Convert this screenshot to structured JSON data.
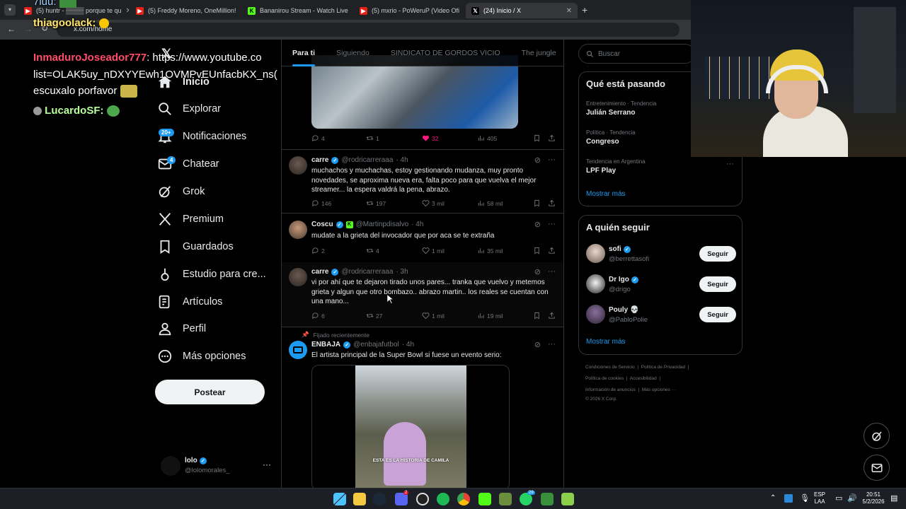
{
  "browser": {
    "tabs": [
      {
        "title": "(5) huntr - ▒▒▒▒ porque te qu",
        "icon": "youtube-icon"
      },
      {
        "title": "(5) Freddy Moreno, OneMillion!",
        "icon": "youtube-icon"
      },
      {
        "title": "Bananirou Stream - Watch Live",
        "icon": "kick-icon"
      },
      {
        "title": "(5) mxrio - PoWeruP (Video Ofi",
        "icon": "youtube-icon"
      },
      {
        "title": "(24) Inicio / X",
        "icon": "x-icon"
      }
    ],
    "url": "x.com/home"
  },
  "overlay_chat": {
    "line0": "7luu:",
    "line1_user": "thiagoolack:",
    "line2_user": "InmaduroJoseador777",
    "line2_text": ": https://www.youtube.co",
    "line3": "list=OLAK5uy_nDXYYEwh1OVMPvEUnfacbKX_ns(",
    "line4": "escuxalo porfavor",
    "line5_user": "LucardoSF:"
  },
  "nav": {
    "home": "Inicio",
    "explore": "Explorar",
    "notifications": "Notificaciones",
    "notifications_badge": "20+",
    "chat": "Chatear",
    "chat_badge": "4",
    "grok": "Grok",
    "premium": "Premium",
    "bookmarks": "Guardados",
    "studio": "Estudio para cre...",
    "articles": "Artículos",
    "profile": "Perfil",
    "more": "Más opciones",
    "post": "Postear",
    "account_name": "lolo",
    "account_handle": "@lolomorales_"
  },
  "timeline": {
    "tabs": [
      "Para ti",
      "Siguiendo",
      "SINDICATO DE GORDOS VICIO",
      "The jungle"
    ],
    "first_tweet_stats": {
      "replies": "4",
      "reposts": "1",
      "likes": "32",
      "views": "405"
    },
    "tweets": [
      {
        "name": "carre",
        "handle": "@rodricarreraaa",
        "time": "· 4h",
        "text": "muchachos y muchachas, estoy gestionando mudanza, muy pronto novedades, se aproxima nueva era, falta poco para que vuelva el mejor streamer... la espera valdrá la pena, abrazo.",
        "replies": "146",
        "reposts": "197",
        "likes": "3 mil",
        "views": "58 mil"
      },
      {
        "name": "Coscu",
        "handle": "@Martinpdisalvo",
        "time": "· 4h",
        "text": "mudate a la grieta del invocador que por aca se te extraña",
        "replies": "2",
        "reposts": "4",
        "likes": "1 mil",
        "views": "35 mil"
      },
      {
        "name": "carre",
        "handle": "@rodricarreraaa",
        "time": "· 3h",
        "text": "vi por ahí que te dejaron tirado unos pares... tranka que vuelvo y metemos grieta y algun que otro bombazo.. abrazo martin.. los reales se cuentan con una mano...",
        "replies": "6",
        "reposts": "27",
        "likes": "1 mil",
        "views": "19 mil"
      }
    ],
    "pinned_label": "Fijado recientemente",
    "pinned": {
      "name": "ENBAJA",
      "handle": "@enbajafutbol",
      "time": "· 4h",
      "text": "El artista principal de la Super Bowl si fuese un evento serio:",
      "video_caption": "ESTA ES LA HISTORIA DE CAMILA"
    }
  },
  "right": {
    "search_placeholder": "Buscar",
    "trends_title": "Qué está pasando",
    "trends": [
      {
        "context": "Entretenimiento · Tendencia",
        "name": "Julián Serrano"
      },
      {
        "context": "Política · Tendencia",
        "name": "Congreso"
      },
      {
        "context": "Tendencia en Argentina",
        "name": "LPF Play"
      }
    ],
    "show_more": "Mostrar más",
    "follow_title": "A quién seguir",
    "follow": [
      {
        "name": "sofi",
        "handle": "@berrettasofi"
      },
      {
        "name": "Dr Igo",
        "handle": "@drigo"
      },
      {
        "name": "Pouly 💀",
        "handle": "@PabloPolie"
      }
    ],
    "follow_button": "Seguir",
    "show_more2": "Mostrar más",
    "footer": {
      "terms": "Condiciones de Servicio",
      "privacy": "Política de Privacidad",
      "cookies": "Política de cookies",
      "accessibility": "Accesibilidad",
      "ads": "Información de anuncios",
      "more": "Más opciones ···",
      "copyright": "© 2026 X Corp."
    }
  },
  "taskbar": {
    "lang_top": "ESP",
    "lang_bottom": "LAA",
    "time": "20:51",
    "date": "5/2/2026",
    "discord_badge": "2",
    "whatsapp_badge": "29"
  },
  "colors": {
    "accent": "#1d9bf0",
    "like": "#f91880",
    "background": "#000000",
    "border": "#2f3336",
    "muted": "#71767b"
  }
}
